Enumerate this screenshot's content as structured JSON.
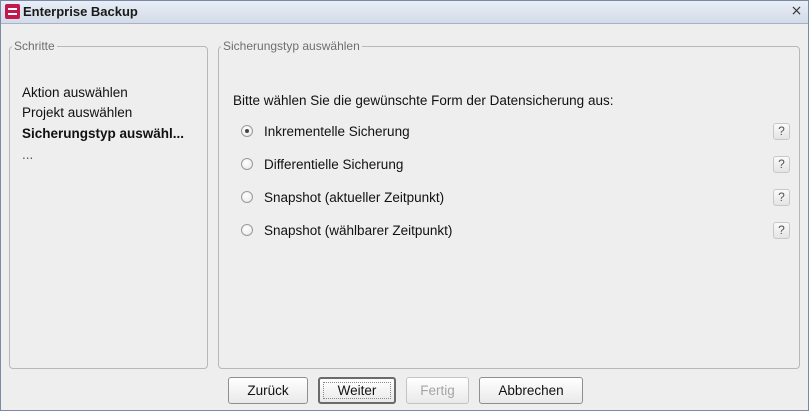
{
  "window": {
    "title": "Enterprise Backup",
    "close_symbol": "×"
  },
  "steps": {
    "legend": "Schritte",
    "items": [
      {
        "label": "Aktion auswählen",
        "current": false
      },
      {
        "label": "Projekt auswählen",
        "current": false
      },
      {
        "label": "Sicherungstyp auswähl...",
        "current": true
      },
      {
        "label": "...",
        "current": false
      }
    ]
  },
  "backup_type": {
    "legend": "Sicherungstyp auswählen",
    "prompt": "Bitte wählen Sie die gewünschte Form der Datensicherung aus:",
    "options": [
      {
        "label": "Inkrementelle Sicherung",
        "selected": true,
        "help": "?"
      },
      {
        "label": "Differentielle Sicherung",
        "selected": false,
        "help": "?"
      },
      {
        "label": "Snapshot (aktueller Zeitpunkt)",
        "selected": false,
        "help": "?"
      },
      {
        "label": "Snapshot (wählbarer Zeitpunkt)",
        "selected": false,
        "help": "?"
      }
    ]
  },
  "buttons": {
    "back": "Zurück",
    "next": "Weiter",
    "finish": "Fertig",
    "cancel": "Abbrechen"
  },
  "colors": {
    "app_icon": "#c2184d",
    "titlebar": "#d3dbe8"
  },
  "icons": {
    "app": "enterprise-backup-icon",
    "close": "close-icon",
    "help": "help-icon"
  }
}
